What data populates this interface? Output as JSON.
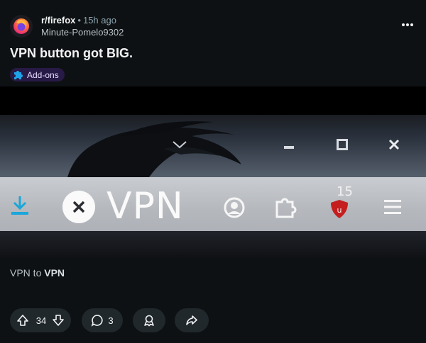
{
  "post": {
    "subreddit": "r/firefox",
    "separator": "•",
    "time": "15h ago",
    "author": "Minute-Pomelo9302",
    "title": "VPN button got BIG.",
    "flair": "Add-ons",
    "body_prefix": "VPN to ",
    "body_bold": "VPN"
  },
  "screenshot": {
    "vpn_label": "VPN",
    "badge_count": "15"
  },
  "actions": {
    "votes": "34",
    "comments": "3"
  },
  "colors": {
    "background": "#0e1113",
    "pill": "#20282c",
    "flair_bg": "#281a46",
    "vote_accent": "#d7dfe2"
  }
}
